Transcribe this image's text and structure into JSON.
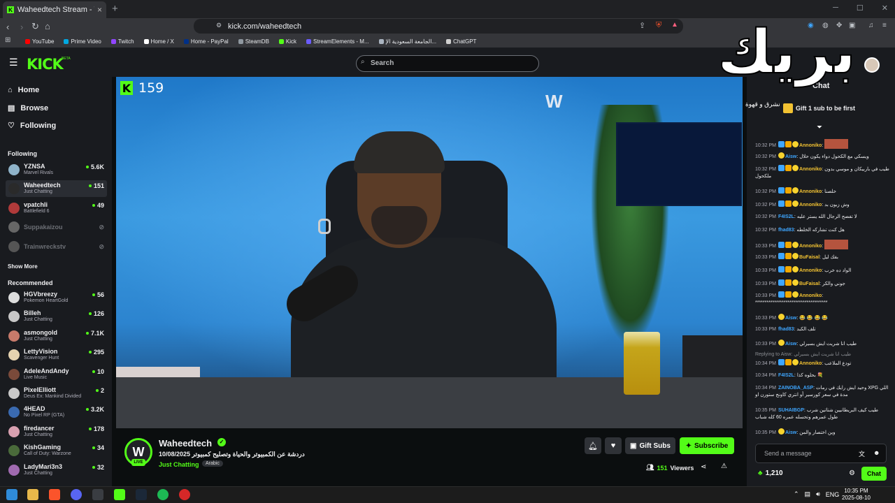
{
  "browser": {
    "tab_title": "Waheedtech Stream - Watch",
    "tab_close": "×",
    "new_tab": "+",
    "url": "kick.com/waheedtech",
    "bookmarks": [
      {
        "label": "YouTube",
        "color": "#ff0000"
      },
      {
        "label": "Prime Video",
        "color": "#00a8e1"
      },
      {
        "label": "Twitch",
        "color": "#9146ff"
      },
      {
        "label": "Home / X",
        "color": "#ffffff"
      },
      {
        "label": "Home - PayPal",
        "color": "#003087"
      },
      {
        "label": "SteamDB",
        "color": "#8f98a0"
      },
      {
        "label": "Kick",
        "color": "#53fc18"
      },
      {
        "label": "StreamElements - M...",
        "color": "#6b5cff"
      },
      {
        "label": "الجامعة السعودية الإ...",
        "color": "#aab4c0"
      },
      {
        "label": "ChatGPT",
        "color": "#d0d0d0"
      }
    ]
  },
  "kick": {
    "logo": "KICK",
    "beta": "BETA",
    "search_placeholder": "Search",
    "nav": [
      {
        "label": "Home",
        "icon": "home-icon"
      },
      {
        "label": "Browse",
        "icon": "browse-icon"
      },
      {
        "label": "Following",
        "icon": "heart-icon"
      }
    ],
    "following_heading": "Following",
    "following": [
      {
        "name": "YZNSA",
        "game": "Marvel Rivals",
        "viewers": "5.6K",
        "color": "#8fb3c9"
      },
      {
        "name": "Waheedtech",
        "game": "Just Chatting",
        "viewers": "151",
        "color": "#2a2a2a"
      },
      {
        "name": "vpatchli",
        "game": "Battlefield 6",
        "viewers": "49",
        "color": "#b03a3a"
      },
      {
        "name": "Suppakaizou",
        "game": "",
        "viewers": "",
        "color": "#666666"
      },
      {
        "name": "Trainwreckstv",
        "game": "",
        "viewers": "",
        "color": "#555555"
      }
    ],
    "show_more": "Show More",
    "recommended_heading": "Recommended",
    "recommended": [
      {
        "name": "HGVbreezy",
        "game": "Pokemon HeartGold",
        "viewers": "56",
        "color": "#dddddd"
      },
      {
        "name": "Billeh",
        "game": "Just Chatting",
        "viewers": "126",
        "color": "#c7c7c7"
      },
      {
        "name": "asmongold",
        "game": "Just Chatting",
        "viewers": "7.1K",
        "color": "#c77a6a"
      },
      {
        "name": "LettyVision",
        "game": "Scavenger Hunt",
        "viewers": "295",
        "color": "#e6d3b0"
      },
      {
        "name": "AdeleAndAndy",
        "game": "Live Music",
        "viewers": "10",
        "color": "#7a4a3a"
      },
      {
        "name": "PixelElliott",
        "game": "Deus Ex: Mankind Divided",
        "viewers": "2",
        "color": "#c9c9c9"
      },
      {
        "name": "4HEAD",
        "game": "No Pixel RP (GTA)",
        "viewers": "3.2K",
        "color": "#3a6ab0"
      },
      {
        "name": "firedancer",
        "game": "Just Chatting",
        "viewers": "178",
        "color": "#d8a0b0"
      },
      {
        "name": "KishGaming",
        "game": "Call of Duty: Warzone",
        "viewers": "34",
        "color": "#4a6a3a"
      },
      {
        "name": "LadyMari3n3",
        "game": "Just Chatting",
        "viewers": "32",
        "color": "#a06ab0"
      }
    ]
  },
  "video": {
    "viewer_badge": "159",
    "shirt_logo": "W"
  },
  "stream": {
    "avatar_letter": "W",
    "live": "LIVE",
    "name": "Waheedtech",
    "title": "دردشة عن الكمبيوتر والحياة وتصليح كمبيوتر 10/08/2025",
    "category": "Just Chatting",
    "tag": "Arabic",
    "gift_subs": "Gift Subs",
    "subscribe": "Subscribe",
    "viewers_count": "151",
    "viewers_label": "Viewers"
  },
  "chat": {
    "header": "Chat",
    "overlay_text": "بريك",
    "overlay_sub": "نشرق و قهوة",
    "pinned": "Gift 1 sub to be first",
    "messages": [
      {
        "time": "10:32 PM",
        "badges": [
          "b1",
          "b2",
          "b3"
        ],
        "user": "Annoniko",
        "ucolor": "#f2c232",
        "text": "",
        "emote": true
      },
      {
        "time": "10:32 PM",
        "badges": [
          "b3"
        ],
        "user": "Aisw",
        "ucolor": "#3ea6ff",
        "text": "ويسكي مع الكحول دواء يكون حلال",
        "emote": false
      },
      {
        "time": "10:32 PM",
        "badges": [
          "b1",
          "b2",
          "b3"
        ],
        "user": "Annoniko",
        "ucolor": "#f2c232",
        "text": "طيب في باربيكان و موسي بدون ملكحول",
        "emote": false
      },
      {
        "time": "10:32 PM",
        "badges": [
          "b1",
          "b2",
          "b3"
        ],
        "user": "Annoniko",
        "ucolor": "#f2c232",
        "text": "خلصنا",
        "emote": false
      },
      {
        "time": "10:32 PM",
        "badges": [
          "b1",
          "b2",
          "b3"
        ],
        "user": "Annoniko",
        "ucolor": "#f2c232",
        "text": "وش زبون بد",
        "emote": false
      },
      {
        "time": "10:32 PM",
        "badges": [],
        "user": "F4IS2L",
        "ucolor": "#3ea6ff",
        "text": "لا تفضح الرجال الله يستر عليه",
        "emote": false
      },
      {
        "time": "10:32 PM",
        "badges": [],
        "user": "fhad83",
        "ucolor": "#3ea6ff",
        "text": "هل كنت تشاركه الخلطه",
        "emote": false
      },
      {
        "time": "10:33 PM",
        "badges": [
          "b1",
          "b2",
          "b3"
        ],
        "user": "Annoniko",
        "ucolor": "#f2c232",
        "text": "",
        "emote": true
      },
      {
        "time": "10:33 PM",
        "badges": [
          "b1",
          "b2",
          "b3"
        ],
        "user": "BuFaisal",
        "ucolor": "#f2c232",
        "text": "بفك ليل",
        "emote": false
      },
      {
        "time": "10:33 PM",
        "badges": [
          "b1",
          "b2",
          "b3"
        ],
        "user": "Annoniko",
        "ucolor": "#f2c232",
        "text": "الواد ده خرب",
        "emote": false
      },
      {
        "time": "10:33 PM",
        "badges": [
          "b1",
          "b2",
          "b3"
        ],
        "user": "BuFaisal",
        "ucolor": "#f2c232",
        "text": "جوني والكر",
        "emote": false
      },
      {
        "time": "10:33 PM",
        "badges": [
          "b1",
          "b2",
          "b3"
        ],
        "user": "Annoniko",
        "ucolor": "#f2c232",
        "text": "**************************************",
        "emote": false
      },
      {
        "time": "10:33 PM",
        "badges": [
          "b3"
        ],
        "user": "Aisw",
        "ucolor": "#3ea6ff",
        "text": "😂 😂 😂 😂",
        "emote": false
      },
      {
        "time": "10:33 PM",
        "badges": [],
        "user": "fhad83",
        "ucolor": "#3ea6ff",
        "text": "تلف الكبد",
        "emote": false
      },
      {
        "time": "10:33 PM",
        "badges": [
          "b3"
        ],
        "user": "Aisw",
        "ucolor": "#3ea6ff",
        "text": "طيب انا شريت ايش بسيرلي",
        "emote": false
      },
      {
        "time": "10:34 PM",
        "badges": [
          "b1",
          "b2",
          "b3"
        ],
        "user": "Annoniko",
        "ucolor": "#f2c232",
        "text": "تودع الملاعب",
        "emote": false
      },
      {
        "time": "10:34 PM",
        "badges": [],
        "user": "F4IS2L",
        "ucolor": "#3ea6ff",
        "text": "بحلوه كذا 💐",
        "emote": false
      },
      {
        "time": "10:34 PM",
        "badges": [],
        "user": "ZAINOBA_ASP",
        "ucolor": "#3ea6ff",
        "text": "وحيد ايش رايك في رمات XPG اللي مدة في سعر كورسير أو انتري كاونج ستورن او",
        "emote": false
      },
      {
        "time": "10:35 PM",
        "badges": [],
        "user": "SUHAIBGP",
        "ucolor": "#3ea6ff",
        "text": "طيب كيف البريطانيين شتاتين شرب طول عمرهم وتحسله عمره 60 كله شباب",
        "emote": false
      },
      {
        "time": "10:35 PM",
        "badges": [
          "b3"
        ],
        "user": "Aisw",
        "ucolor": "#3ea6ff",
        "text": "وين اختصار والمن",
        "emote": false
      }
    ],
    "reply_note": "Replying to Aisw: طيب انا شريت ايش بسيرلي",
    "input_placeholder": "Send a message",
    "points": "1,210",
    "chat_button": "Chat"
  },
  "taskbar": {
    "lang": "ENG",
    "time": "10:35 PM",
    "date": "2025-08-10"
  }
}
